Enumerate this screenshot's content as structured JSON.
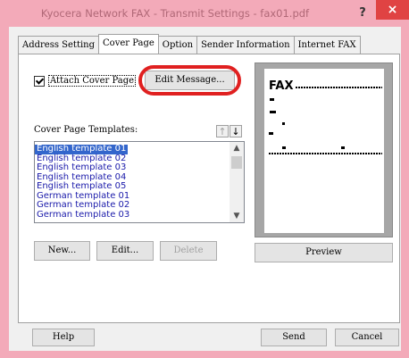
{
  "window": {
    "title": "Kyocera Network FAX - Transmit Settings - fax01.pdf",
    "help_glyph": "?",
    "close_glyph": "×"
  },
  "tabs": [
    {
      "label": "Address Setting",
      "active": false
    },
    {
      "label": "Cover Page",
      "active": true
    },
    {
      "label": "Option",
      "active": false
    },
    {
      "label": "Sender Information",
      "active": false
    },
    {
      "label": "Internet FAX",
      "active": false
    }
  ],
  "cover_page": {
    "attach_label": "Attach Cover Page",
    "attach_checked": true,
    "edit_message_label": "Edit Message...",
    "templates_label": "Cover Page Templates:",
    "move_up_glyph": "↑",
    "move_down_glyph": "↓",
    "templates": [
      "English template 01",
      "English template 02",
      "English template 03",
      "English template 04",
      "English template 05",
      "German template 01",
      "German template 02",
      "German template 03"
    ],
    "selected_template": "English template 01",
    "new_label": "New...",
    "edit_label": "Edit...",
    "delete_label": "Delete",
    "preview_label": "Preview",
    "preview_fax_text": "FAX"
  },
  "footer": {
    "help_label": "Help",
    "send_label": "Send",
    "cancel_label": "Cancel"
  },
  "colors": {
    "titlebar": "#f3aab9",
    "close": "#e04343",
    "highlight": "#e02020",
    "selection": "#3366cc"
  }
}
